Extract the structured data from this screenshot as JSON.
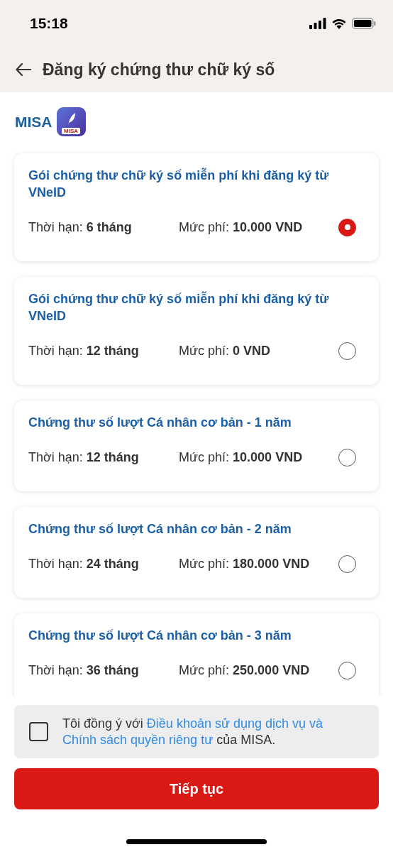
{
  "status_bar": {
    "time": "15:18"
  },
  "header": {
    "title": "Đăng ký chứng thư chữ ký số"
  },
  "provider": {
    "name": "MISA",
    "icon_label": "MISA"
  },
  "packages": [
    {
      "title": "Gói chứng thư chữ ký số miễn phí khi đăng ký từ VNeID",
      "duration": "Thời hạn: **6 tháng**",
      "fee": "Mức phí: **10.000 VND**",
      "selected": true
    },
    {
      "title": "Gói chứng thư chữ ký số miễn phí khi đăng ký từ VNeID",
      "duration": "Thời hạn: **12 tháng**",
      "fee": "Mức phí: **0 VND**",
      "selected": false
    },
    {
      "title": "Chứng thư số lượt Cá nhân cơ bản - 1 năm",
      "duration": "Thời hạn: **12 tháng**",
      "fee": "Mức phí: **10.000 VND**",
      "selected": false
    },
    {
      "title": "Chứng thư số lượt Cá nhân cơ bản - 2 năm",
      "duration": "Thời hạn: **24 tháng**",
      "fee": "Mức phí: **180.000 VND**",
      "selected": false
    },
    {
      "title": "Chứng thư số lượt Cá nhân cơ bản - 3 năm",
      "duration": "Thời hạn: **36 tháng**",
      "fee": "Mức phí: **250.000 VND**",
      "selected": false
    }
  ],
  "agreement": {
    "checked": false,
    "parts": [
      {
        "kind": "text",
        "text": "Tôi đồng ý với "
      },
      {
        "kind": "link",
        "text": "Điều khoản sử dụng dịch vụ và"
      },
      {
        "kind": "link",
        "text": "Chính sách quyền riêng tư"
      },
      {
        "kind": "text",
        "text": " của MISA."
      }
    ]
  },
  "continue_button": {
    "label": "Tiếp tục"
  }
}
